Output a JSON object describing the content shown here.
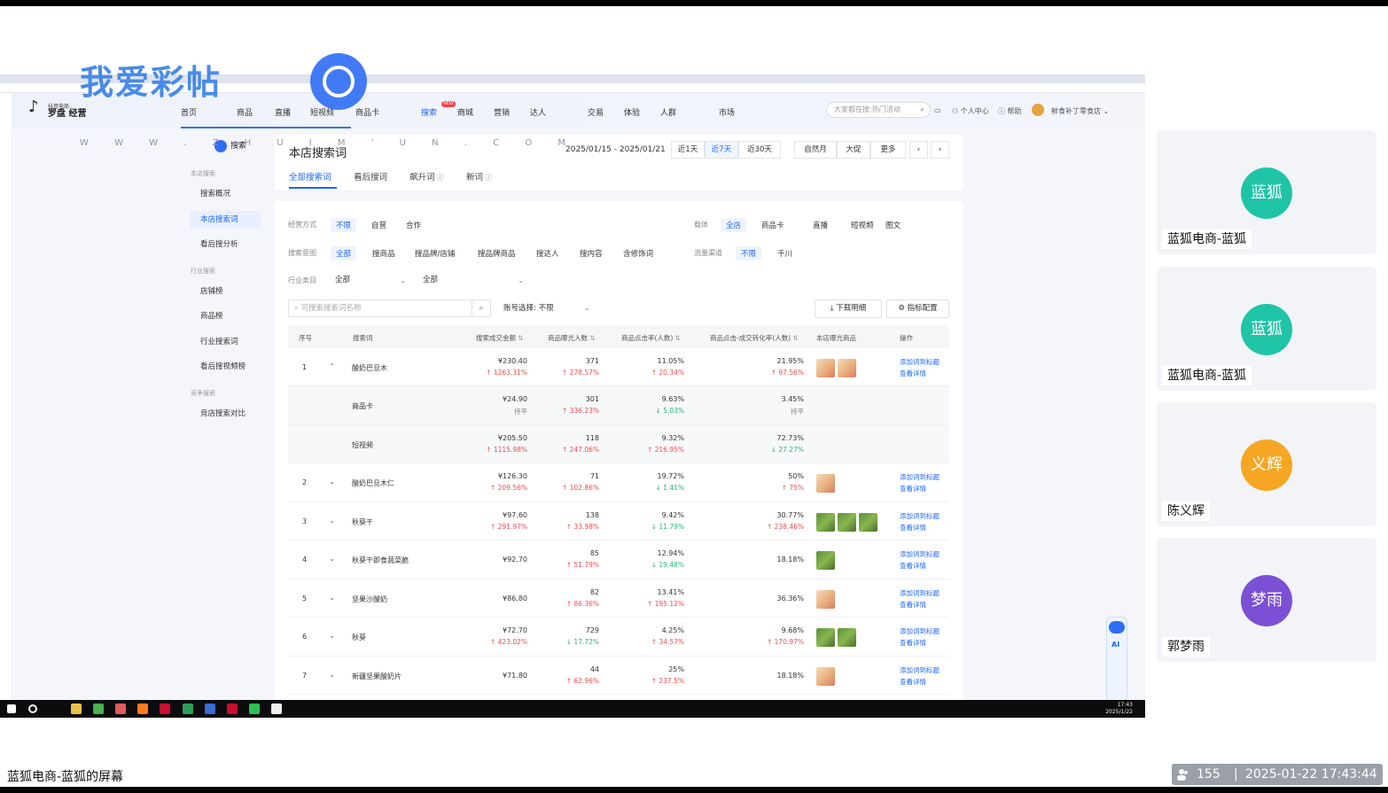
{
  "watermark": {
    "title": "我爱彩帖",
    "sub": "W W W . Z H U I M ' U N . C O M"
  },
  "browser": {
    "tabs": [
      "",
      "",
      "",
      "",
      "",
      "",
      "",
      ""
    ]
  },
  "app": {
    "logo_sub": "抖音电商",
    "logo_main": "罗盘 经营",
    "nav": [
      "首页",
      "商品",
      "直播",
      "短视频",
      "商品卡",
      "搜索",
      "商城",
      "营销",
      "达人",
      "交易",
      "体验",
      "人群",
      "市场"
    ],
    "new_badge": "NEW",
    "search_placeholder": "大家都在搜:热门活动",
    "meta": {
      "user_center": "个人中心",
      "help": "帮助",
      "shop": "鲜食补丁零食店"
    }
  },
  "sidebar": {
    "header": "搜索",
    "groups": [
      {
        "label": "本店搜索",
        "items": [
          "搜索概况",
          "本店搜索词",
          "看后搜分析"
        ]
      },
      {
        "label": "行业搜索",
        "items": [
          "店铺榜",
          "商品榜",
          "行业搜索词",
          "看后搜视频榜"
        ]
      },
      {
        "label": "竞争搜索",
        "items": [
          "竞店搜索对比"
        ]
      }
    ]
  },
  "page": {
    "title": "本店搜索词",
    "date_range": "2025/01/15 - 2025/01/21",
    "date_buttons": [
      "近1天",
      "近7天",
      "近30天",
      "自然月",
      "大促",
      "更多"
    ],
    "prev": "‹",
    "next": "›",
    "tabs": [
      "全部搜索词",
      "看后搜词",
      "飙升词",
      "新词"
    ]
  },
  "filters": {
    "mode_label": "经营方式",
    "mode_opts": [
      "不限",
      "自营",
      "合作"
    ],
    "carrier_label": "载体",
    "carrier_opts": [
      "全店",
      "商品卡",
      "直播",
      "短视频",
      "图文"
    ],
    "intent_label": "搜索意图",
    "intent_opts": [
      "全部",
      "搜商品",
      "搜品牌/店铺",
      "搜品牌商品",
      "搜达人",
      "搜内容",
      "含修饰词"
    ],
    "channel_label": "流量渠道",
    "channel_opts": [
      "不限",
      "千川"
    ],
    "category_label": "行业类目",
    "category_sel": [
      "全部",
      "全部"
    ],
    "search_placeholder": "可搜索搜索词名称",
    "account": "账号选择: 不限",
    "download": "下载明细",
    "config": "指标配置"
  },
  "table": {
    "headers": [
      "序号",
      "搜索词",
      "搜索成交金额",
      "商品曝光人数",
      "商品点击率(人数)",
      "商品点击-成交转化率(人数)",
      "本店曝光商品",
      "操作"
    ],
    "op1": "添加词到标题",
    "op2": "查看详情",
    "rows": [
      {
        "idx": "1",
        "word": "酸奶巴旦木",
        "amt": "¥230.40",
        "amt_d": "1263.31%",
        "amt_dir": "up",
        "exp": "371",
        "exp_d": "278.57%",
        "exp_dir": "up",
        "ctr": "11.05%",
        "ctr_d": "20.34%",
        "ctr_dir": "up",
        "cvr": "21.95%",
        "cvr_d": "97.56%",
        "cvr_dir": "up",
        "thumbs": [
          "food",
          "food"
        ],
        "expanded": true
      },
      {
        "idx": "",
        "word": "商品卡",
        "amt": "¥24.90",
        "amt_d": "持平",
        "amt_dir": "flat",
        "exp": "301",
        "exp_d": "336.23%",
        "exp_dir": "up",
        "ctr": "9.63%",
        "ctr_d": "5.03%",
        "ctr_dir": "down",
        "cvr": "3.45%",
        "cvr_d": "持平",
        "cvr_dir": "flat",
        "thumbs": [],
        "sub": true
      },
      {
        "idx": "",
        "word": "短视频",
        "amt": "¥205.50",
        "amt_d": "1115.98%",
        "amt_dir": "up",
        "exp": "118",
        "exp_d": "247.06%",
        "exp_dir": "up",
        "ctr": "9.32%",
        "ctr_d": "216.95%",
        "ctr_dir": "up",
        "cvr": "72.73%",
        "cvr_d": "27.27%",
        "cvr_dir": "down",
        "thumbs": [],
        "sub": true
      },
      {
        "idx": "2",
        "word": "酸奶巴旦木仁",
        "amt": "¥126.30",
        "amt_d": "209.56%",
        "amt_dir": "up",
        "exp": "71",
        "exp_d": "102.86%",
        "exp_dir": "up",
        "ctr": "19.72%",
        "ctr_d": "1.41%",
        "ctr_dir": "down",
        "cvr": "50%",
        "cvr_d": "75%",
        "cvr_dir": "up",
        "thumbs": [
          "food"
        ]
      },
      {
        "idx": "3",
        "word": "秋葵干",
        "amt": "¥97.60",
        "amt_d": "291.97%",
        "amt_dir": "up",
        "exp": "138",
        "exp_d": "33.98%",
        "exp_dir": "up",
        "ctr": "9.42%",
        "ctr_d": "11.79%",
        "ctr_dir": "down",
        "cvr": "30.77%",
        "cvr_d": "238.46%",
        "cvr_dir": "up",
        "thumbs": [
          "veg",
          "veg",
          "veg"
        ]
      },
      {
        "idx": "4",
        "word": "秋葵干即食蔬菜脆",
        "amt": "¥92.70",
        "amt_d": "",
        "amt_dir": "",
        "exp": "85",
        "exp_d": "51.79%",
        "exp_dir": "up",
        "ctr": "12.94%",
        "ctr_d": "19.48%",
        "ctr_dir": "down",
        "cvr": "18.18%",
        "cvr_d": "",
        "cvr_dir": "",
        "thumbs": [
          "veg"
        ]
      },
      {
        "idx": "5",
        "word": "坚果沙酸奶",
        "amt": "¥86.80",
        "amt_d": "",
        "amt_dir": "",
        "exp": "82",
        "exp_d": "86.36%",
        "exp_dir": "up",
        "ctr": "13.41%",
        "ctr_d": "195.12%",
        "ctr_dir": "up",
        "cvr": "36.36%",
        "cvr_d": "",
        "cvr_dir": "",
        "thumbs": [
          "food"
        ]
      },
      {
        "idx": "6",
        "word": "秋葵",
        "amt": "¥72.70",
        "amt_d": "423.02%",
        "amt_dir": "up",
        "exp": "729",
        "exp_d": "17.72%",
        "exp_dir": "down",
        "ctr": "4.25%",
        "ctr_d": "34.57%",
        "ctr_dir": "up",
        "cvr": "9.68%",
        "cvr_d": "170.97%",
        "cvr_dir": "up",
        "thumbs": [
          "veg",
          "veg"
        ]
      },
      {
        "idx": "7",
        "word": "新疆坚果酸奶片",
        "amt": "¥71.80",
        "amt_d": "",
        "amt_dir": "",
        "exp": "44",
        "exp_d": "62.96%",
        "exp_dir": "up",
        "ctr": "25%",
        "ctr_d": "237.5%",
        "ctr_dir": "up",
        "cvr": "18.18%",
        "cvr_d": "",
        "cvr_dir": "",
        "thumbs": [
          "food"
        ]
      }
    ]
  },
  "robot": {
    "label": "AI"
  },
  "taskbar": {
    "time": "17:43",
    "date": "2025/1/22"
  },
  "participants": [
    {
      "avatar": "蓝狐",
      "name": "蓝狐电商-蓝狐",
      "color": "#1fc4a6"
    },
    {
      "avatar": "蓝狐",
      "name": "蓝狐电商-蓝狐",
      "color": "#1fc4a6"
    },
    {
      "avatar": "义辉",
      "name": "陈义辉",
      "color": "#f5a623"
    },
    {
      "avatar": "梦雨",
      "name": "郭梦雨",
      "color": "#7b4fd6"
    }
  ],
  "footer": {
    "screen_label": "蓝狐电商-蓝狐的屏幕",
    "viewers": "155",
    "sep": "|",
    "timestamp": "2025-01-22 17:43:44"
  }
}
